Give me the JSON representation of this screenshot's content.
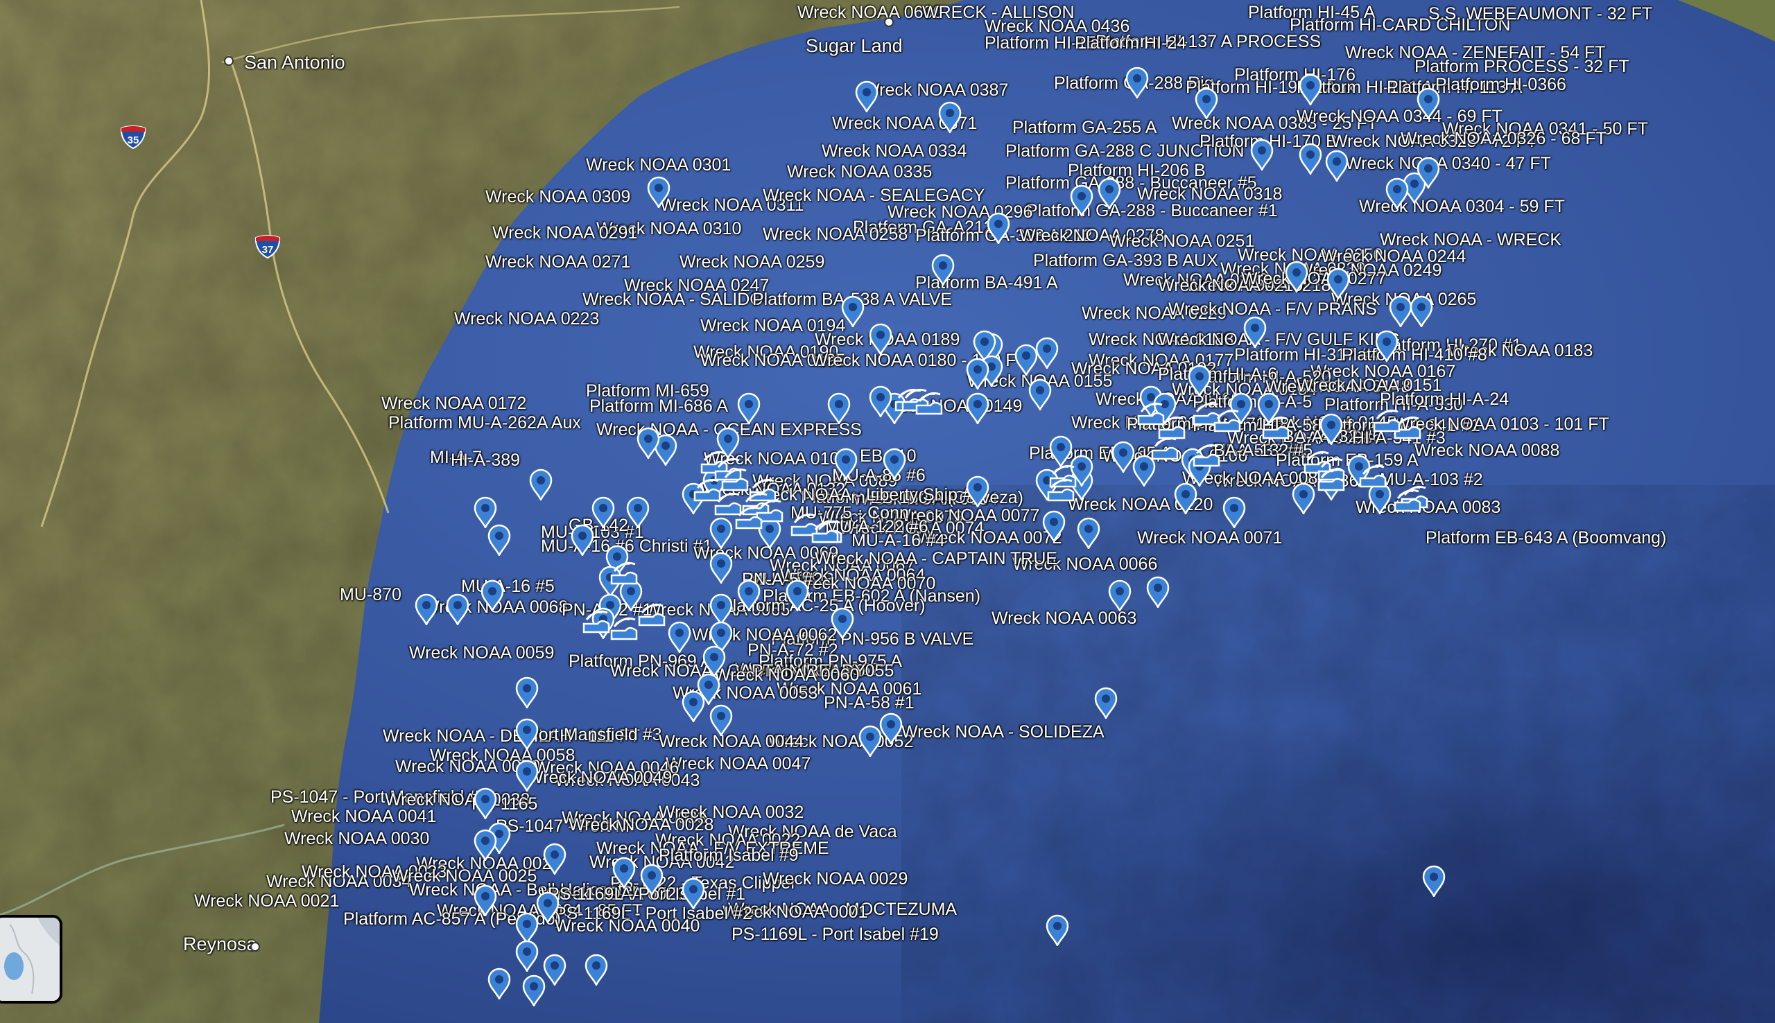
{
  "map": {
    "cities": [
      {
        "name": "San Antonio"
      },
      {
        "name": "Sugar Land"
      },
      {
        "name": "Reynosa"
      }
    ],
    "highways": [
      {
        "number": "35"
      },
      {
        "number": "37"
      }
    ],
    "labels": [
      "Wreck NOAA 0600",
      "WRECK - ALLISON",
      "Platform HI-45 A",
      "Platform HI-CARD CHILTON",
      "S.S. WEBEAUMONT - 32 FT",
      "Wreck NOAA 0436",
      "Platform HI-137 A PROCESS",
      "Wreck NOAA - ZENEFAIT - 54 FT",
      "Platform HI-15",
      "Platform HI-24",
      "Platform PROCESS - 32 FT",
      "Wreck NOAA 0387",
      "Platform GA-288 Rig",
      "Platform HI-199 A Aux",
      "Platform HI-131 A",
      "Platform HI-113 A",
      "Platform HI-176",
      "Platform HI-0366",
      "Wreck NOAA 0371",
      "Platform GA-255 A",
      "Wreck NOAA 0383 - 25 FT",
      "Wreck NOAA 0341 - 50 FT",
      "Wreck NOAA 0344 - 69 FT",
      "Wreck NOAA 0334",
      "Platform GA-288 C JUNCTION",
      "Platform HI-170 B",
      "Wreck NOAA 0323 - 72 FT",
      "Wreck NOAA 0326 - 68 FT",
      "Wreck NOAA 0301",
      "Platform HI-206 B",
      "Wreck NOAA 0335",
      "Wreck NOAA 0340 - 47 FT",
      "Wreck NOAA 0309",
      "Platform GA-288 - Buccaneer #5",
      "Wreck NOAA 0318",
      "Wreck NOAA 0304 - 59 FT",
      "Wreck NOAA 0310",
      "Wreck NOAA 0311",
      "Platform GA-288 - Buccaneer #1",
      "Wreck NOAA - SEALEGACY",
      "Wreck NOAA 0296",
      "Platform GA-A212",
      "Wreck NOAA - WRECK",
      "Wreck NOAA 0291",
      "Wreck NOAA 0258",
      "Platform GA-393 A 212",
      "Wreck NOAA 0278",
      "Wreck NOAA 0251",
      "Wreck NOAA 0250",
      "Wreck NOAA 0244",
      "Wreck NOAA 0271",
      "Wreck NOAA 0259",
      "Platform GA-393 B AUX",
      "Wreck NOAA 0238",
      "Wreck NOAA 0249",
      "Platform BA-491 A",
      "Wreck NOAA 0222 - 113 FT",
      "Wreck NOAA 0218",
      "Wreck NOAA 0219",
      "Wreck NOAA 0277",
      "Wreck NOAA 0265",
      "Wreck NOAA 0247",
      "Wreck NOAA - SALIDO",
      "Platform BA-538 A VALVE",
      "Wreck NOAA 0229",
      "Wreck NOAA - F/V PRANS",
      "Wreck NOAA 0223",
      "Wreck NOAA 0194",
      "Wreck NOAA 0189",
      "Wreck NOAA 0188",
      "Wreck NOAA - F/V GULF KING",
      "Platform HI-270 #1",
      "Wreck NOAA 0183",
      "Wreck NOAA 0190",
      "Wreck NOAA 0195",
      "Wreck NOAA 0180 - 120 FT",
      "Wreck NOAA 0177",
      "Platform HI-317 #4",
      "Platform HI-410 #8",
      "Wreck NOAA 0167",
      "Platform MI-659",
      "Wreck NOAA 0192",
      "Platform HI-A-520",
      "Platform HI-A-6",
      "Wreck NOAA 0172",
      "Platform MI-686 A",
      "Wreck NOAA 0149",
      "Wreck NOAA 0155",
      "Wreck NOAA 0160",
      "Wreck NOAA 0154",
      "Platform HI-A-5",
      "Wreck NOAA 0148",
      "Platform HI-A-330",
      "Platform HI-A-24",
      "Wreck NOAA 0151",
      "Platform MU-A-262A Aux",
      "Wreck NOAA - OCEAN EXPRESS",
      "Wreck NOAA 0156",
      "Wreck NOAA 0145",
      "Platform HI-A-571 #8",
      "Platform HI-A-582 #2",
      "Platform HI-A-341 #1",
      "Wreck NOAA 0103 - 101 FT",
      "MI-A-7",
      "Wreck NOAA 0104",
      "EB-110",
      "HI-A-532 #1",
      "Platform EB-165 A",
      "Wreck NOAA 0106",
      "Wreck NOAA 0095",
      "BA-A-132 #6",
      "BA-A-132 #5",
      "HI-A-341 #3",
      "Wreck NOAA 0088",
      "Wreck NOAA 0089",
      "Platform EB-159 A",
      "HI-A-389",
      "MU-A-85 #6",
      "Wreck NOAA 0086",
      "Wreck NOAA 0084",
      "MU-A-103 #2",
      "Wreck NOAA 0132",
      "Platform EB-160 A (Cerveza)",
      "Wreck NOAA 0080",
      "Wreck NOAA 0120",
      "Wreck NOAA 0083",
      "Wreck NOAA - Liberty Ship #5",
      "Wreck NOAA 0079",
      "Wreck NOAA 0077",
      "MU-A-103 #1",
      "GB-142",
      "MU-775 - Conn",
      "Wreck NOAA 0074",
      "Wreck NOAA 0072",
      "MU-A-16 #4",
      "Platform EB-643 A (Boomvang)",
      "Wreck NOAA 0071",
      "MU-A-122 #6",
      "MU-A-16 #6 Christi #1",
      "Wreck NOAA 0069",
      "Wreck NOAA 0066",
      "Wreck NOAA 0067",
      "Wreck NOAA - CAPTAIN TRUE",
      "MU-A-31 B",
      "Wreck NOAA 0064",
      "Wreck NOAA 0070",
      "MU-870",
      "MU-A-16 #5",
      "Platform EB-602 A (Nansen)",
      "Wreck NOAA 0065",
      "Wreck NOAA 0068",
      "PN-A-42 #1",
      "Platform PN-956 B VALVE",
      "PN-A-5 #2",
      "Platform AC-25 A (Hoover)",
      "Wreck NOAA 0062",
      "Wreck NOAA 0063",
      "Wreck NOAA 0059",
      "PN-A-72 #2",
      "Wreck NOAA 0057",
      "Wreck NOAA 0061",
      "Platform PN-969 A",
      "Platform PN-975 A",
      "Wreck NOAA 0055",
      "Wreck NOAA - CAPTAIN READY",
      "Wreck NOAA 0060",
      "Wreck NOAA 0053",
      "PN-A-58 #1",
      "Wreck NOAA 0052",
      "Wreck NOAA - DELILAH - 111 FT",
      "Wreck NOAA 0058",
      "Wreck NOAA 0050",
      "Wreck NOAA 0047",
      "Port Mansfield #3",
      "Wreck NOAA - SOLIDEZA",
      "Wreck NOAA 0046",
      "Wreck NOAA 0044",
      "Wreck NOAA 0043",
      "Wreck NOAA 0049",
      "PS-1047 - Port Mansfield #2",
      "Wreck NOAA 0041",
      "Wreck NOAA 0038",
      "PS-1165",
      "Wreck NOAA 0033",
      "Wreck NOAA 0032",
      "PS-1047 - Port M",
      "Wreck NOAA 0028",
      "Wreck NOAA de Vaca",
      "Wreck NOAA 0030",
      "Wreck NOAA 0034",
      "Wreck NOAA 0022",
      "Wreck NOAA - F/V EXTREME",
      "Wreck NOAA 0027",
      "Wreck NOAA 0042",
      "Platform Isabel #9",
      "Wreck NOAA 0023",
      "Wreck NOAA 0025",
      "PS-1122 - Texas Clipper",
      "Wreck NOAA 0029",
      "Wreck NOAA - Bell Helicopter",
      "Wreck NOAA 0020",
      "Wreck NOAA - MOCTEZUMA",
      "Wreck NOAA 0021",
      "PS-1169L - Port Isabel #1",
      "Wreck NOAA 0001",
      "Wreck NOAA 0004 - 85 FT",
      "PS-1169L - Port Isabel #2",
      "PS-1169L - Port Isabel #19",
      "Platform AC-857 A (Perdido)",
      "Wreck NOAA 0040"
    ]
  },
  "colors": {
    "land": "#7d7a52",
    "shelf": "#3d5fa8",
    "deep": "#24386e",
    "pin": "#3b82d6",
    "label": "#ffffff"
  }
}
